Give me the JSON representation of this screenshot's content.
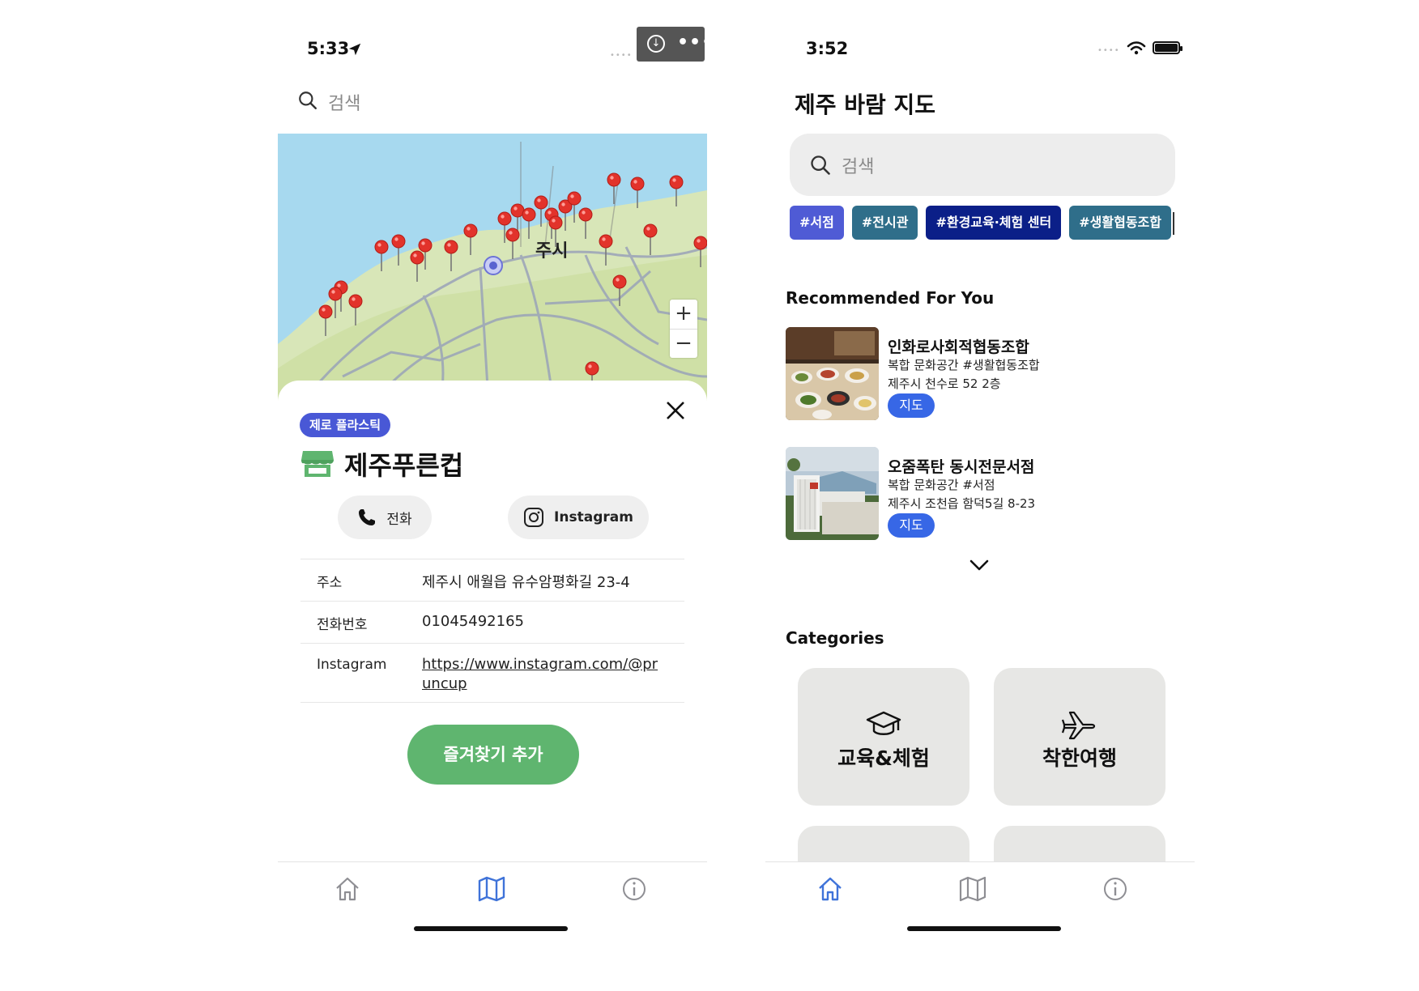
{
  "left_screen": {
    "status": {
      "time": "5:33"
    },
    "search": {
      "placeholder": "검색"
    },
    "map": {
      "city_label": "주시",
      "zoom_in": "+",
      "zoom_out": "−"
    },
    "place": {
      "category_tag": "제로 플라스틱",
      "name": "제주푸른컵",
      "call_label": "전화",
      "instagram_label": "Instagram",
      "details": [
        {
          "label": "주소",
          "value": "제주시 애월읍 유수암평화길 23-4"
        },
        {
          "label": "전화번호",
          "value": "01045492165"
        },
        {
          "label": "Instagram",
          "value": "https://www.instagram.com/@pruncup"
        }
      ],
      "favorite_label": "즐겨찾기 추가"
    },
    "tabs": {
      "active": "map"
    }
  },
  "right_screen": {
    "status": {
      "time": "3:52"
    },
    "app_title": "제주 바람 지도",
    "search": {
      "placeholder": "검색"
    },
    "chips": [
      {
        "label": "#서점",
        "color": "#4f5bd5"
      },
      {
        "label": "#전시관",
        "color": "#2f6e8a"
      },
      {
        "label": "#환경교육·체험 센터",
        "color": "#0b1f88"
      },
      {
        "label": "#생활협동조합",
        "color": "#2f6e8a"
      }
    ],
    "recommended_title": "Recommended For You",
    "recommended": [
      {
        "name": "인화로사회적협동조합",
        "desc": "복합 문화공간 #생활협동조합",
        "address": "제주시 천수로 52 2층",
        "button": "지도",
        "thumb_icon": "restaurant-food-photo"
      },
      {
        "name": "오줌폭탄 동시전문서점",
        "desc": "복합 문화공간 #서점",
        "address": "제주시 조천읍 함덕5길 8-23",
        "button": "지도",
        "thumb_icon": "bookstore-building-photo"
      }
    ],
    "categories_title": "Categories",
    "categories": [
      {
        "label": "교육&체험",
        "icon": "graduation-cap-icon"
      },
      {
        "label": "착한여행",
        "icon": "airplane-icon"
      },
      {
        "label": "",
        "icon": ""
      },
      {
        "label": "",
        "icon": ""
      }
    ],
    "tabs": {
      "active": "home"
    }
  },
  "colors": {
    "tab_active": "#3f73d9",
    "tab_inactive": "#8e8e93",
    "favorite_green": "#5fb56f",
    "tag_purple": "#4958d6",
    "map_button_blue": "#3767e6"
  }
}
